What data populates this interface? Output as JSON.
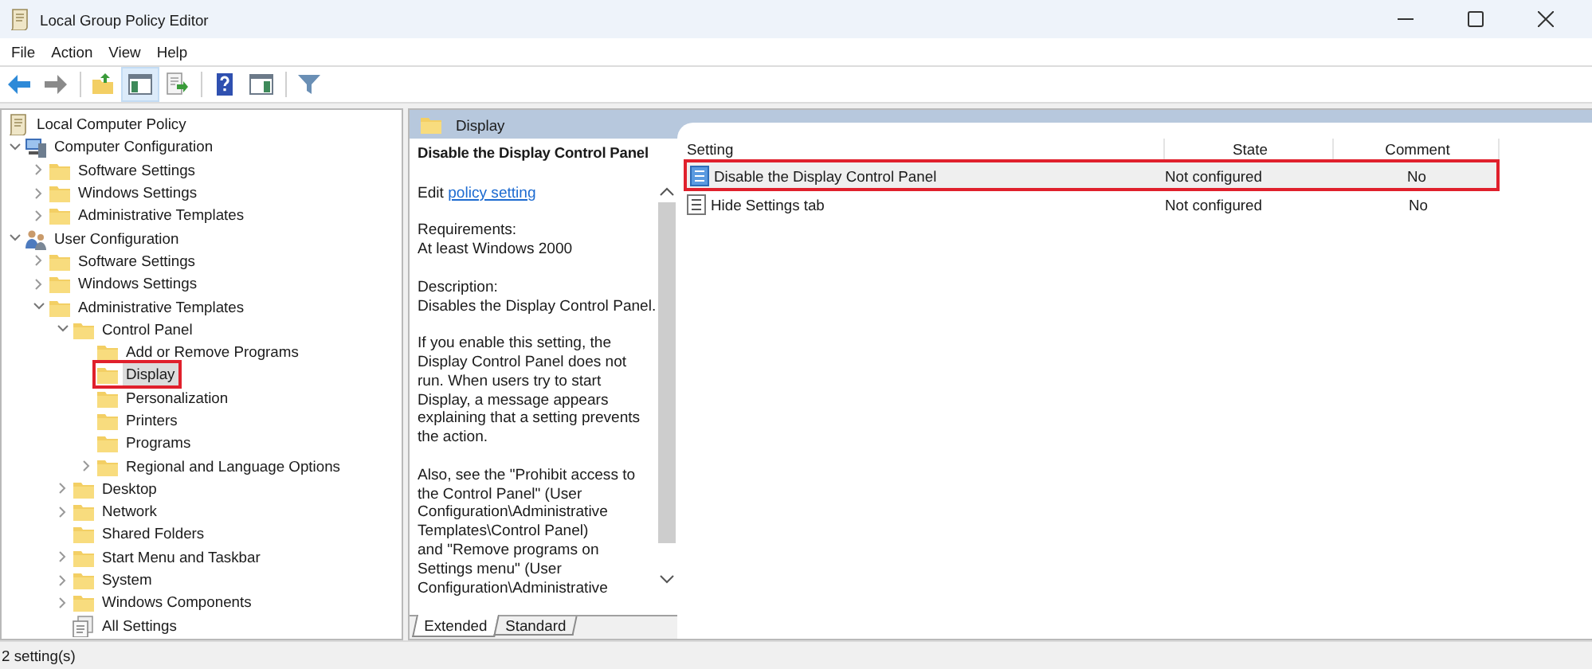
{
  "window": {
    "title": "Local Group Policy Editor"
  },
  "menu": [
    "File",
    "Action",
    "View",
    "Help"
  ],
  "toolbar": [
    {
      "kind": "back",
      "pressed": false
    },
    {
      "kind": "forward",
      "pressed": false
    },
    {
      "kind": "up",
      "pressed": false
    },
    {
      "kind": "tree",
      "pressed": true
    },
    {
      "kind": "export",
      "pressed": false
    },
    {
      "kind": "help",
      "pressed": false
    },
    {
      "kind": "pane",
      "pressed": false
    },
    {
      "kind": "filter",
      "pressed": false
    }
  ],
  "tree": [
    {
      "label": "Local Computer Policy",
      "kind": "policy",
      "selected": false,
      "highlighted": false,
      "children": [
        {
          "label": "Computer Configuration",
          "kind": "computer",
          "expanded": true,
          "selected": false,
          "highlighted": false,
          "children": [
            {
              "label": "Software Settings",
              "kind": "folder",
              "expanded": false,
              "selected": false,
              "highlighted": false
            },
            {
              "label": "Windows Settings",
              "kind": "folder",
              "expanded": false,
              "selected": false,
              "highlighted": false
            },
            {
              "label": "Administrative Templates",
              "kind": "folder",
              "expanded": false,
              "selected": false,
              "highlighted": false
            }
          ]
        },
        {
          "label": "User Configuration",
          "kind": "user",
          "expanded": true,
          "selected": false,
          "highlighted": false,
          "children": [
            {
              "label": "Software Settings",
              "kind": "folder",
              "expanded": false,
              "selected": false,
              "highlighted": false
            },
            {
              "label": "Windows Settings",
              "kind": "folder",
              "expanded": false,
              "selected": false,
              "highlighted": false
            },
            {
              "label": "Administrative Templates",
              "kind": "folder",
              "expanded": true,
              "selected": false,
              "highlighted": false,
              "children": [
                {
                  "label": "Control Panel",
                  "kind": "folder",
                  "expanded": true,
                  "selected": false,
                  "highlighted": false,
                  "children": [
                    {
                      "label": "Add or Remove Programs",
                      "kind": "folder",
                      "selected": false,
                      "highlighted": false
                    },
                    {
                      "label": "Display",
                      "kind": "folder",
                      "selected": true,
                      "highlighted": true
                    },
                    {
                      "label": "Personalization",
                      "kind": "folder",
                      "selected": false,
                      "highlighted": false
                    },
                    {
                      "label": "Printers",
                      "kind": "folder",
                      "selected": false,
                      "highlighted": false
                    },
                    {
                      "label": "Programs",
                      "kind": "folder",
                      "selected": false,
                      "highlighted": false
                    },
                    {
                      "label": "Regional and Language Options",
                      "kind": "folder",
                      "expanded": false,
                      "selected": false,
                      "highlighted": false
                    }
                  ]
                },
                {
                  "label": "Desktop",
                  "kind": "folder",
                  "expanded": false,
                  "selected": false,
                  "highlighted": false
                },
                {
                  "label": "Network",
                  "kind": "folder",
                  "expanded": false,
                  "selected": false,
                  "highlighted": false
                },
                {
                  "label": "Shared Folders",
                  "kind": "folder",
                  "selected": false,
                  "highlighted": false
                },
                {
                  "label": "Start Menu and Taskbar",
                  "kind": "folder",
                  "expanded": false,
                  "selected": false,
                  "highlighted": false
                },
                {
                  "label": "System",
                  "kind": "folder",
                  "expanded": false,
                  "selected": false,
                  "highlighted": false
                },
                {
                  "label": "Windows Components",
                  "kind": "folder",
                  "expanded": false,
                  "selected": false,
                  "highlighted": false
                },
                {
                  "label": "All Settings",
                  "kind": "allsettings",
                  "selected": false,
                  "highlighted": false
                }
              ]
            }
          ]
        }
      ]
    }
  ],
  "details": {
    "header": "Display",
    "title": "Disable the Display Control Panel",
    "edit_prefix": "Edit",
    "edit_link": "policy setting",
    "paragraphs": [
      "Requirements:\nAt least Windows 2000",
      "Description:\nDisables the Display Control Panel.",
      "If you enable this setting, the Display Control Panel does not run. When users try to start Display, a message appears explaining that a setting prevents the action.",
      "Also, see the \"Prohibit access to the Control Panel\" (User Configuration\\Administrative Templates\\Control Panel)\nand \"Remove programs on Settings menu\" (User Configuration\\Administrative"
    ]
  },
  "table": {
    "columns": [
      "Setting",
      "State",
      "Comment"
    ],
    "rows": [
      {
        "setting": "Disable the Display Control Panel",
        "state": "Not configured",
        "comment": "No",
        "selected": true,
        "highlighted": true
      },
      {
        "setting": "Hide Settings tab",
        "state": "Not configured",
        "comment": "No",
        "selected": false,
        "highlighted": false
      }
    ]
  },
  "tabs": [
    {
      "label": "Extended",
      "selected": true
    },
    {
      "label": "Standard",
      "selected": false
    }
  ],
  "status_bar": "2 setting(s)"
}
